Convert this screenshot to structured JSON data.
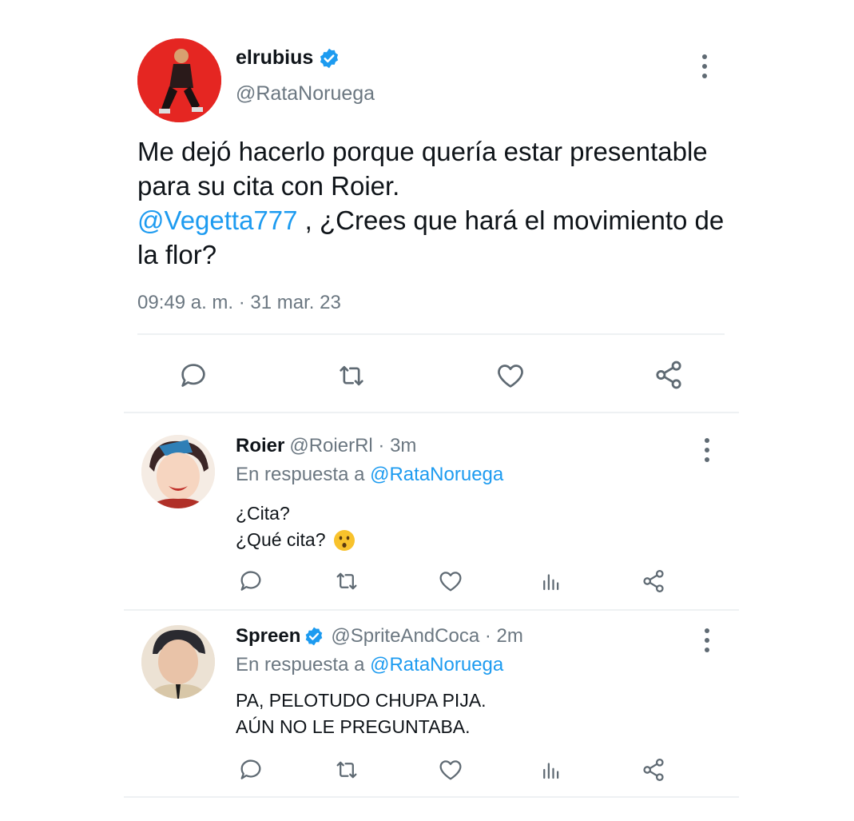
{
  "main_tweet": {
    "name": "elrubius",
    "handle": "@RataNoruega",
    "text_1": "Me dejó hacerlo porque quería estar presentable para su cita con Roier.",
    "mention": "@Vegetta777",
    "text_2": " , ¿Crees que hará el movimiento de la flor?",
    "timestamp": "09:49 a. m. · 31 mar. 23"
  },
  "replies": [
    {
      "name": "Roier",
      "handle_time": "@RoierRl · 3m",
      "reply_prefix": "En respuesta a",
      "reply_mention": "@RataNoruega",
      "line_1": "¿Cita?",
      "line_2": "¿Qué cita?"
    },
    {
      "name": "Spreen",
      "handle_time": "@SpriteAndCoca · 2m",
      "reply_prefix": "En respuesta a",
      "reply_mention": "@RataNoruega",
      "line_1": "PA, PELOTUDO CHUPA PIJA.",
      "line_2": "AÚN NO LE PREGUNTABA."
    }
  ],
  "colors": {
    "accent": "#1d9bf0",
    "muted": "#6b7781",
    "icon": "#5f6a73"
  }
}
